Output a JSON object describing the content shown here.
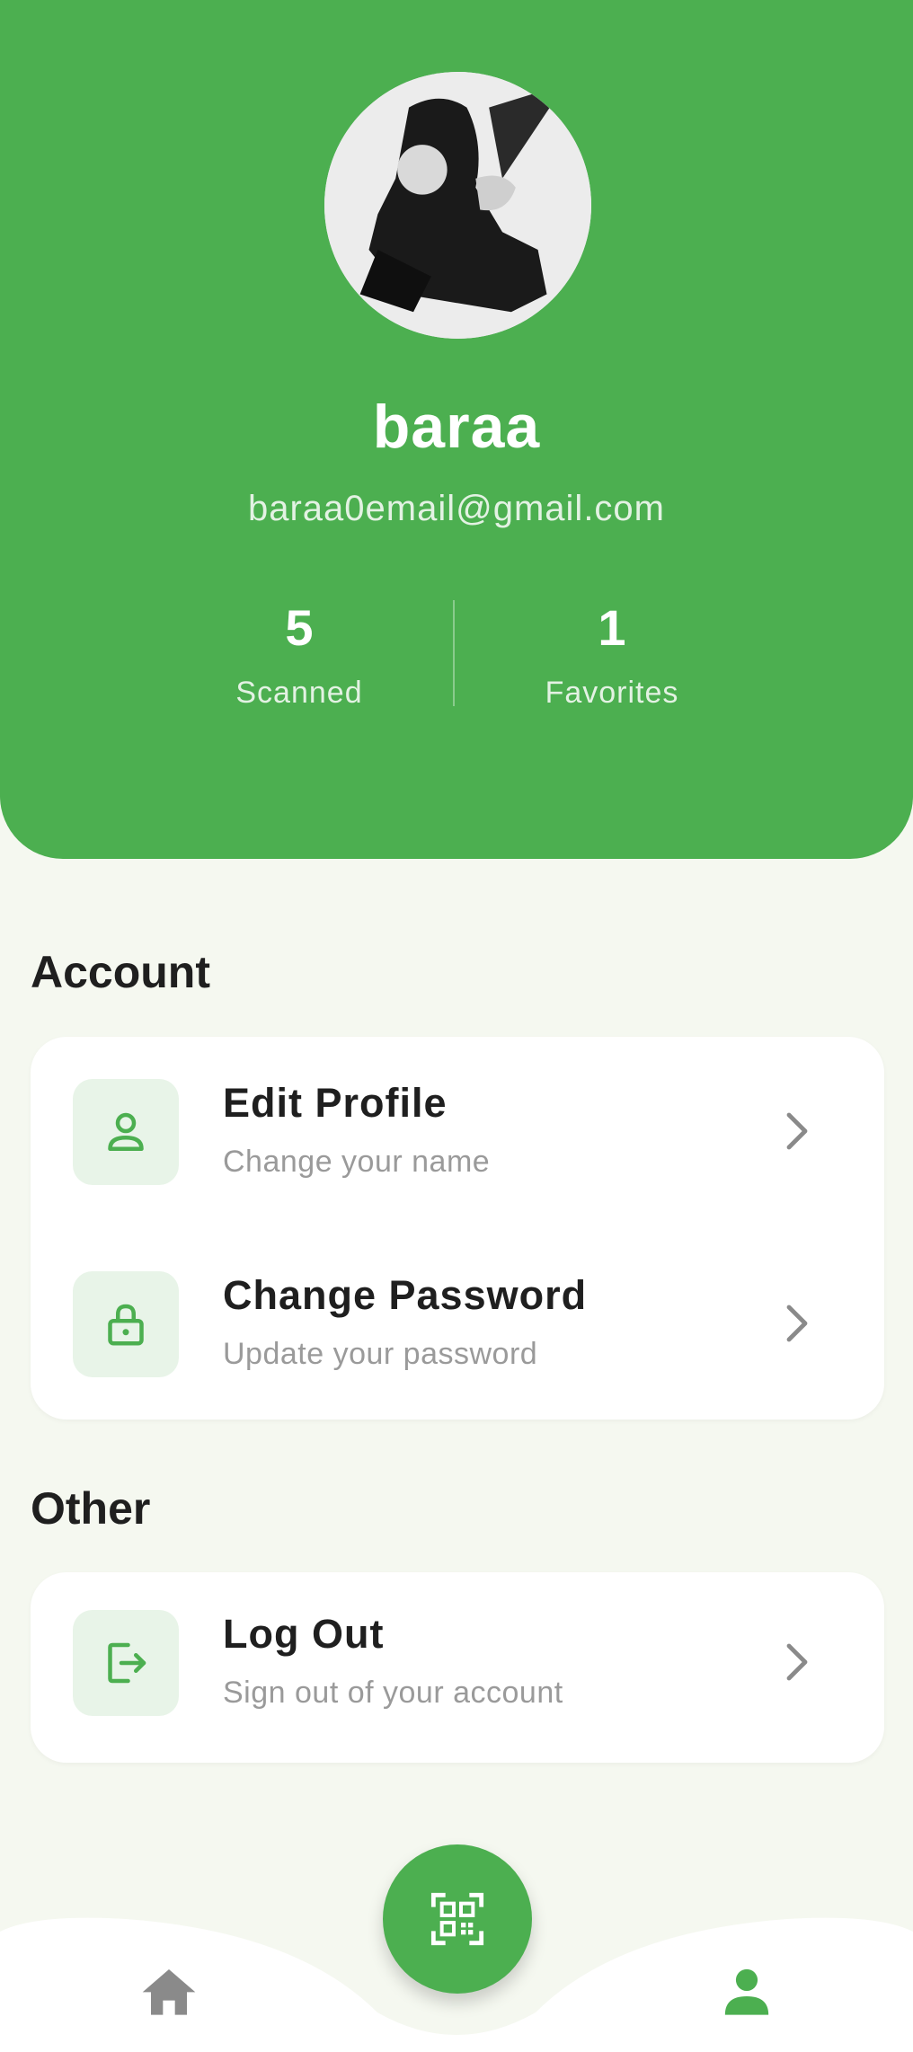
{
  "profile": {
    "name": "baraa",
    "email": "baraa0email@gmail.com",
    "stats": {
      "scanned": {
        "value": "5",
        "label": "Scanned"
      },
      "favorites": {
        "value": "1",
        "label": "Favorites"
      }
    }
  },
  "sections": {
    "account": {
      "title": "Account",
      "items": [
        {
          "title": "Edit Profile",
          "subtitle": "Change your name",
          "icon": "person-icon"
        },
        {
          "title": "Change Password",
          "subtitle": "Update your password",
          "icon": "lock-icon"
        }
      ]
    },
    "other": {
      "title": "Other",
      "items": [
        {
          "title": "Log Out",
          "subtitle": "Sign out of your account",
          "icon": "logout-icon"
        }
      ]
    }
  },
  "bottom_nav": {
    "items": [
      {
        "icon": "home-icon"
      },
      {
        "icon": "qr-scan-icon"
      },
      {
        "icon": "profile-icon",
        "active": true
      }
    ]
  },
  "colors": {
    "primary": "#4caf50",
    "background": "#f5f8f0",
    "icon_tile": "#e8f4e8",
    "inactive_icon": "#8a8a8a",
    "text_dark": "#1f1f1f",
    "text_muted": "#9a9a9a"
  }
}
